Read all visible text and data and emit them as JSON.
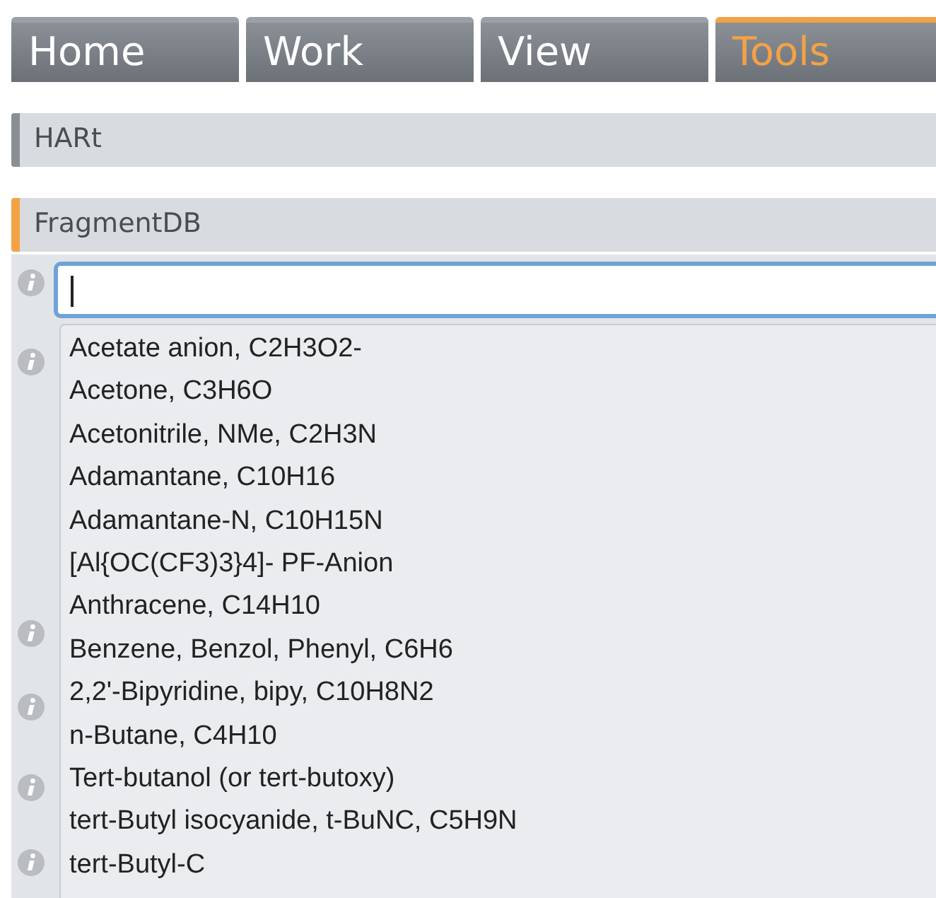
{
  "tabs": [
    {
      "label": "Home",
      "selected": false
    },
    {
      "label": "Work",
      "selected": false
    },
    {
      "label": "View",
      "selected": false
    },
    {
      "label": "Tools",
      "selected": true
    }
  ],
  "sections": [
    {
      "title": "HARt",
      "active": false
    },
    {
      "title": "FragmentDB",
      "active": true
    }
  ],
  "search": {
    "focused": true
  },
  "dropdown": {
    "items": [
      "Acetate anion, C2H3O2-",
      "Acetone, C3H6O",
      "Acetonitrile, NMe, C2H3N",
      "Adamantane, C10H16",
      "Adamantane-N, C10H15N",
      "[Al{OC(CF3)3}4]- PF-Anion",
      "Anthracene, C14H10",
      "Benzene, Benzol, Phenyl, C6H6",
      "2,2'-Bipyridine, bipy, C10H8N2",
      "n-Butane, C4H10",
      "Tert-butanol (or tert-butoxy)",
      "tert-Butyl isocyanide, t-BuNC, C5H9N",
      "tert-Butyl-C"
    ]
  }
}
